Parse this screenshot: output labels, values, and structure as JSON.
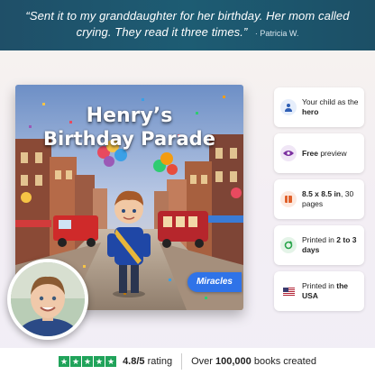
{
  "testimonial": {
    "quote": "“Sent it to my granddaughter for her birthday. Her mom called crying. They read it three times.”",
    "author": "· Patricia W."
  },
  "book": {
    "title_line1": "Henry’s",
    "title_line2": "Birthday Parade",
    "brand": "Miracles"
  },
  "features": [
    {
      "icon": "user-icon",
      "pre": "Your child as the ",
      "bold": "hero",
      "post": "",
      "icon_bg": "#e6eefb",
      "icon_color": "#2f5fb5"
    },
    {
      "icon": "eye-icon",
      "pre": "",
      "bold": "Free",
      "post": " preview",
      "icon_bg": "#f0e6f6",
      "icon_color": "#7b2fa0"
    },
    {
      "icon": "book-icon",
      "pre": "",
      "bold": "8.5 x 8.5 in",
      "post": ", 30 pages",
      "icon_bg": "#fde9df",
      "icon_color": "#e0602a"
    },
    {
      "icon": "refresh-icon",
      "pre": "Printed in ",
      "bold": "2 to 3 days",
      "post": "",
      "icon_bg": "#e4f4e8",
      "icon_color": "#28a44a"
    },
    {
      "icon": "us-flag-icon",
      "pre": "Printed in ",
      "bold": "the USA",
      "post": "",
      "icon_bg": "#ffffff",
      "icon_color": "#b22234"
    }
  ],
  "rating": {
    "stars": 5,
    "score": "4.8/5",
    "label": " rating",
    "count_pre": "Over ",
    "count_bold": "100,000",
    "count_post": " books created"
  }
}
